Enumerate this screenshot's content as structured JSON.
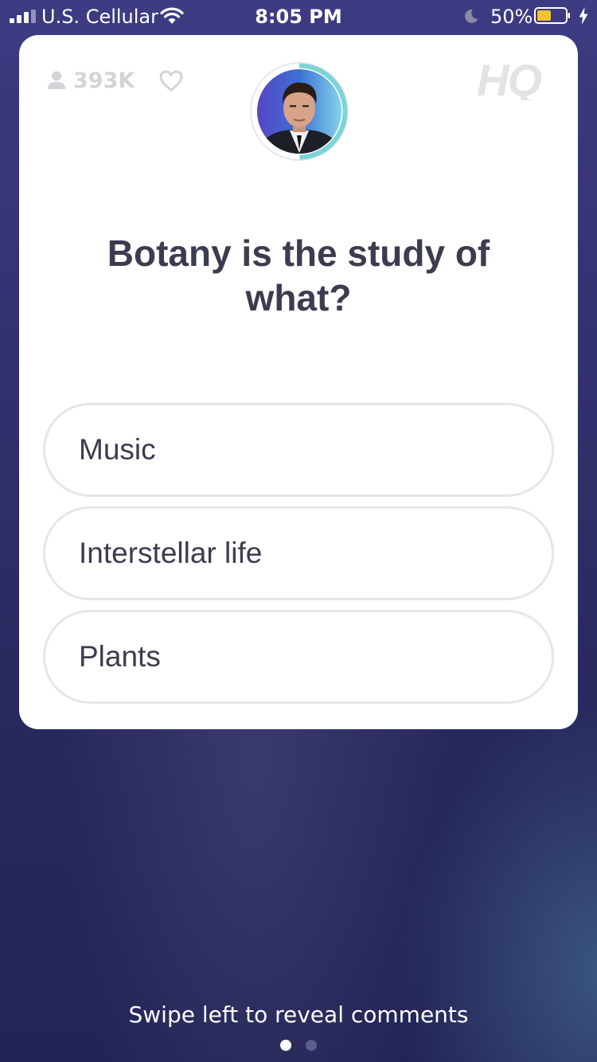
{
  "status_bar": {
    "carrier": "U.S. Cellular",
    "time": "8:05 PM",
    "battery_percent": "50%",
    "battery_level": 0.5,
    "battery_color": "#f5c32c",
    "icons": [
      "signal-icon",
      "wifi-icon",
      "moon-icon",
      "battery-icon",
      "charging-bolt-icon"
    ]
  },
  "card": {
    "viewer_count": "393K",
    "logo_text": "HQ",
    "host_avatar": {
      "timer_color": "#7dd3d8"
    },
    "question": "Botany is the study of what?",
    "answers": [
      {
        "label": "Music"
      },
      {
        "label": "Interstellar life"
      },
      {
        "label": "Plants"
      }
    ]
  },
  "footer": {
    "swipe_hint": "Swipe left to reveal comments",
    "pages": 2,
    "active_page": 0
  },
  "colors": {
    "background": "#2b2b63",
    "card": "#ffffff",
    "text_dark": "#3c3c50",
    "muted": "#d4d4d8",
    "answer_border": "#e6e6e9"
  }
}
